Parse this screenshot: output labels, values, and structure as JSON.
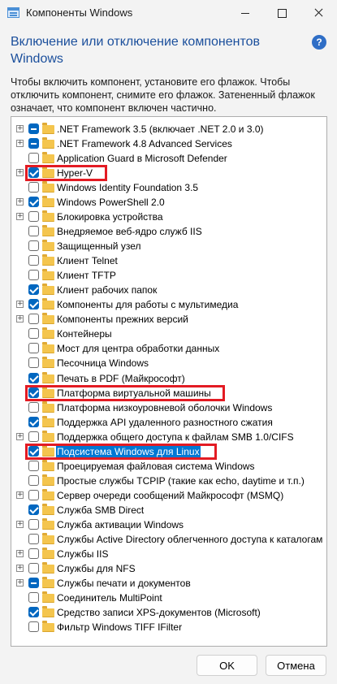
{
  "window": {
    "title": "Компоненты Windows",
    "help_glyph": "?"
  },
  "header": {
    "title": "Включение или отключение компонентов Windows"
  },
  "description": "Чтобы включить компонент, установите его флажок. Чтобы отключить компонент, снимите его флажок. Затененный флажок означает, что компонент включен частично.",
  "features": [
    {
      "label": ".NET Framework 3.5 (включает .NET 2.0 и 3.0)",
      "expandable": true,
      "state": "partial"
    },
    {
      "label": ".NET Framework 4.8 Advanced Services",
      "expandable": true,
      "state": "partial"
    },
    {
      "label": "Application Guard в Microsoft Defender",
      "expandable": false,
      "state": "unchecked"
    },
    {
      "label": "Hyper-V",
      "expandable": true,
      "state": "checked",
      "highlighted": true
    },
    {
      "label": "Windows Identity Foundation 3.5",
      "expandable": false,
      "state": "unchecked"
    },
    {
      "label": "Windows PowerShell 2.0",
      "expandable": true,
      "state": "checked"
    },
    {
      "label": "Блокировка устройства",
      "expandable": true,
      "state": "unchecked"
    },
    {
      "label": "Внедряемое веб-ядро служб IIS",
      "expandable": false,
      "state": "unchecked"
    },
    {
      "label": "Защищенный узел",
      "expandable": false,
      "state": "unchecked"
    },
    {
      "label": "Клиент Telnet",
      "expandable": false,
      "state": "unchecked"
    },
    {
      "label": "Клиент TFTP",
      "expandable": false,
      "state": "unchecked"
    },
    {
      "label": "Клиент рабочих папок",
      "expandable": false,
      "state": "checked"
    },
    {
      "label": "Компоненты для работы с мультимедиа",
      "expandable": true,
      "state": "checked"
    },
    {
      "label": "Компоненты прежних версий",
      "expandable": true,
      "state": "unchecked"
    },
    {
      "label": "Контейнеры",
      "expandable": false,
      "state": "unchecked"
    },
    {
      "label": "Мост для центра обработки данных",
      "expandable": false,
      "state": "unchecked"
    },
    {
      "label": "Песочница Windows",
      "expandable": false,
      "state": "unchecked"
    },
    {
      "label": "Печать в PDF (Майкрософт)",
      "expandable": false,
      "state": "checked"
    },
    {
      "label": "Платформа виртуальной машины",
      "expandable": false,
      "state": "checked",
      "highlighted": true
    },
    {
      "label": "Платформа низкоуровневой оболочки Windows",
      "expandable": false,
      "state": "unchecked"
    },
    {
      "label": "Поддержка API удаленного разностного сжатия",
      "expandable": false,
      "state": "checked"
    },
    {
      "label": "Поддержка общего доступа к файлам SMB 1.0/CIFS",
      "expandable": true,
      "state": "unchecked"
    },
    {
      "label": "Подсистема Windows для Linux",
      "expandable": false,
      "state": "checked",
      "highlighted": true,
      "selected": true
    },
    {
      "label": "Проецируемая файловая система Windows",
      "expandable": false,
      "state": "unchecked"
    },
    {
      "label": "Простые службы TCPIP (такие как echo, daytime и т.п.)",
      "expandable": false,
      "state": "unchecked"
    },
    {
      "label": "Сервер очереди сообщений Майкрософт (MSMQ)",
      "expandable": true,
      "state": "unchecked"
    },
    {
      "label": "Служба SMB Direct",
      "expandable": false,
      "state": "checked"
    },
    {
      "label": "Служба активации Windows",
      "expandable": true,
      "state": "unchecked"
    },
    {
      "label": "Службы Active Directory облегченного доступа к каталогам",
      "expandable": false,
      "state": "unchecked"
    },
    {
      "label": "Службы IIS",
      "expandable": true,
      "state": "unchecked"
    },
    {
      "label": "Службы для NFS",
      "expandable": true,
      "state": "unchecked"
    },
    {
      "label": "Службы печати и документов",
      "expandable": true,
      "state": "partial"
    },
    {
      "label": "Соединитель MultiPoint",
      "expandable": false,
      "state": "unchecked"
    },
    {
      "label": "Средство записи XPS-документов (Microsoft)",
      "expandable": false,
      "state": "checked"
    },
    {
      "label": "Фильтр Windows TIFF IFilter",
      "expandable": false,
      "state": "unchecked"
    }
  ],
  "buttons": {
    "ok": "OK",
    "cancel": "Отмена"
  },
  "colors": {
    "accent": "#0067c0",
    "highlight_box": "#e31b23",
    "title_text": "#1b4f9c"
  }
}
